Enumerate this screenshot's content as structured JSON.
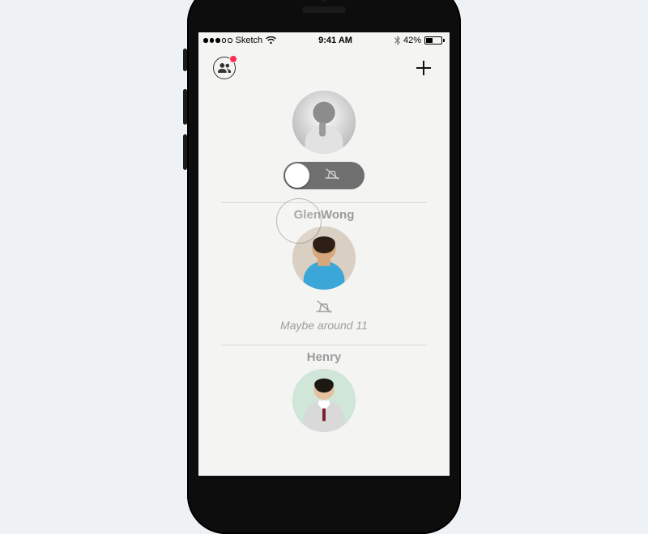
{
  "statusBar": {
    "carrier": "Sketch",
    "time": "9:41 AM",
    "batteryPercent": "42%"
  },
  "me": {
    "toggleState": "off"
  },
  "contacts": [
    {
      "name": "GlenWong",
      "statusIcon": "worktable-muted",
      "statusText": "Maybe around 11"
    },
    {
      "name": "Henry",
      "statusIcon": "",
      "statusText": ""
    }
  ]
}
